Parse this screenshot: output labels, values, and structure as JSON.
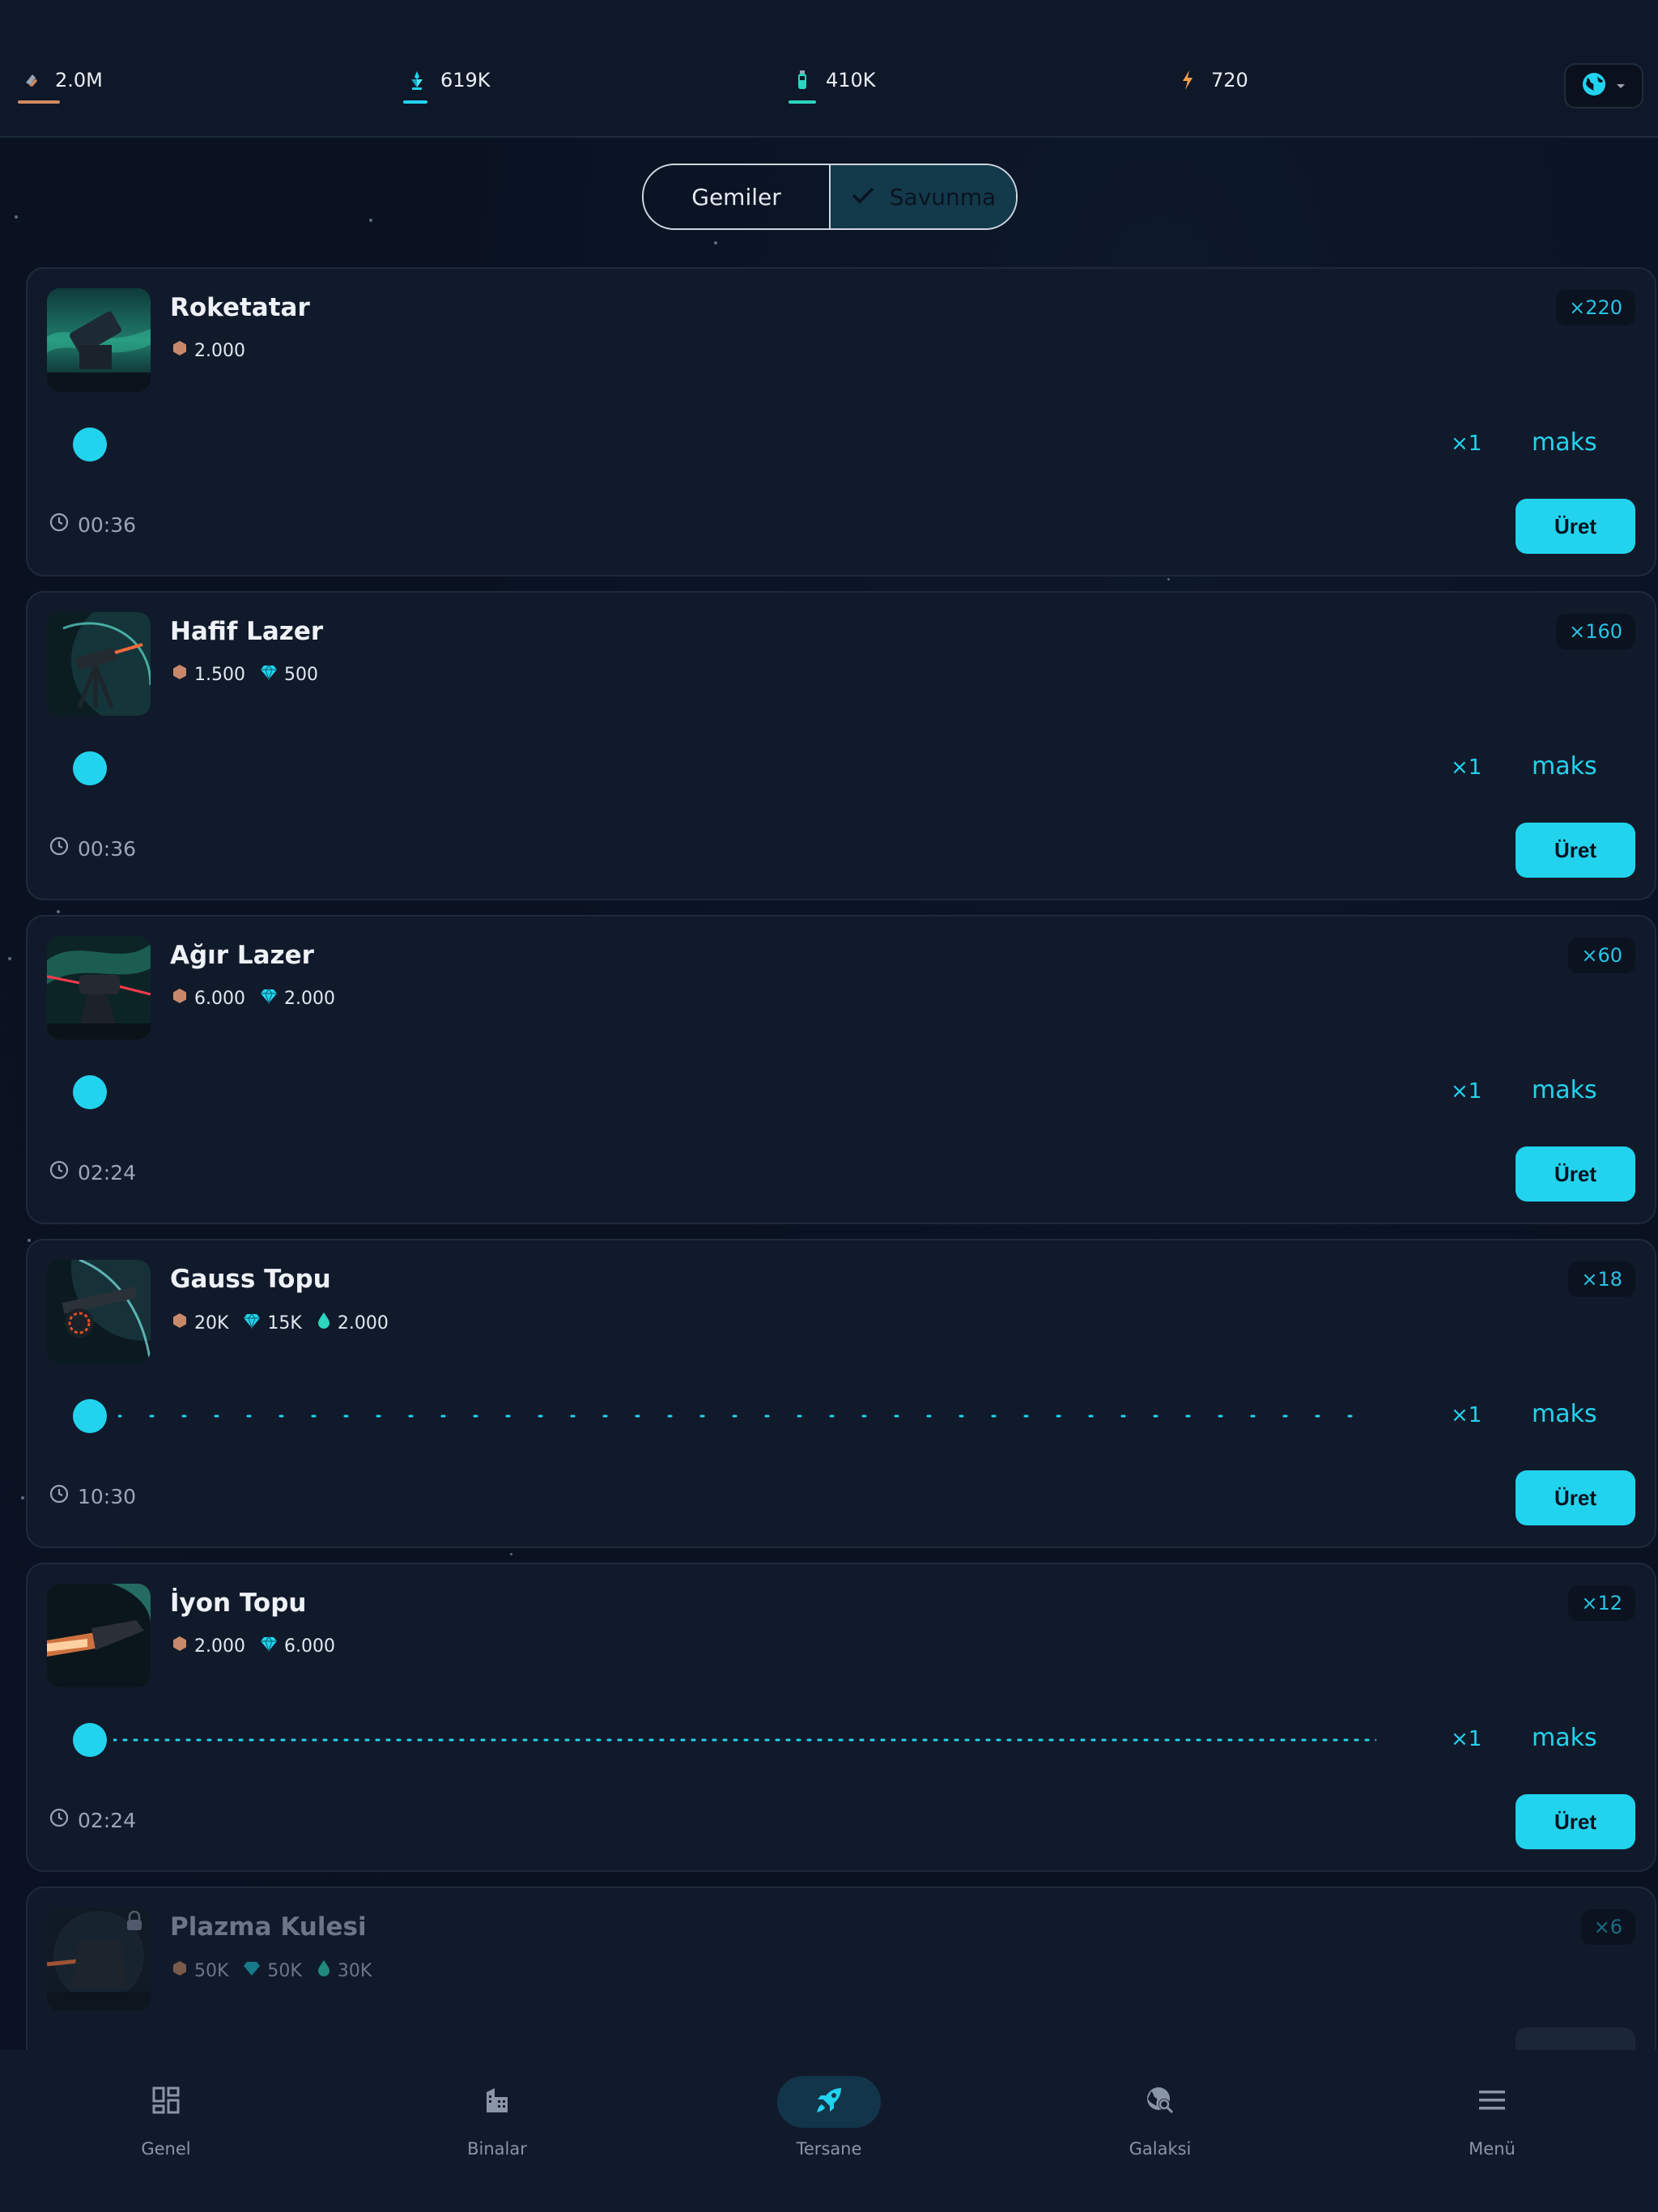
{
  "resources": [
    {
      "name": "metal",
      "value": "2.0M",
      "icon": "metal-icon",
      "color": "#d08a63"
    },
    {
      "name": "crystal",
      "value": "619K",
      "icon": "crystal-icon",
      "color": "#22d3ee"
    },
    {
      "name": "deuterium",
      "value": "410K",
      "icon": "deuterium-icon",
      "color": "#2dd4bf"
    },
    {
      "name": "energy",
      "value": "720",
      "icon": "energy-icon",
      "color": "#f5a04a"
    }
  ],
  "toggle": {
    "ships": "Gemiler",
    "defense": "Savunma",
    "active": "defense"
  },
  "items": [
    {
      "name": "Roketatar",
      "count": "×220",
      "costs": [
        {
          "type": "metal",
          "value": "2.000"
        }
      ],
      "mult": "×1",
      "max": "maks",
      "time": "00:36",
      "build": "Üret",
      "progress": 0.0
    },
    {
      "name": "Hafif Lazer",
      "count": "×160",
      "costs": [
        {
          "type": "metal",
          "value": "1.500"
        },
        {
          "type": "crystal",
          "value": "500"
        }
      ],
      "mult": "×1",
      "max": "maks",
      "time": "00:36",
      "build": "Üret",
      "progress": 0.0
    },
    {
      "name": "Ağır Lazer",
      "count": "×60",
      "costs": [
        {
          "type": "metal",
          "value": "6.000"
        },
        {
          "type": "crystal",
          "value": "2.000"
        }
      ],
      "mult": "×1",
      "max": "maks",
      "time": "02:24",
      "build": "Üret",
      "progress": 0.0
    },
    {
      "name": "Gauss Topu",
      "count": "×18",
      "costs": [
        {
          "type": "metal",
          "value": "20K"
        },
        {
          "type": "crystal",
          "value": "15K"
        },
        {
          "type": "deuterium",
          "value": "2.000"
        }
      ],
      "mult": "×1",
      "max": "maks",
      "time": "10:30",
      "build": "Üret",
      "progress": 0.0
    },
    {
      "name": "İyon Topu",
      "count": "×12",
      "costs": [
        {
          "type": "metal",
          "value": "2.000"
        },
        {
          "type": "crystal",
          "value": "6.000"
        }
      ],
      "mult": "×1",
      "max": "maks",
      "time": "02:24",
      "build": "Üret",
      "progress": 0.0
    },
    {
      "name": "Plazma Kulesi",
      "count": "×6",
      "costs": [
        {
          "type": "metal",
          "value": "50K"
        },
        {
          "type": "crystal",
          "value": "50K"
        },
        {
          "type": "deuterium",
          "value": "30K"
        }
      ],
      "mult": "",
      "max": "",
      "time": "",
      "build": "",
      "progress": 0.0
    }
  ],
  "nav": [
    {
      "label": "Genel",
      "icon": "dashboard-icon"
    },
    {
      "label": "Binalar",
      "icon": "buildings-icon"
    },
    {
      "label": "Tersane",
      "icon": "rocket-icon",
      "active": true
    },
    {
      "label": "Galaksi",
      "icon": "galaxy-search-icon"
    },
    {
      "label": "Menü",
      "icon": "hamburger-icon"
    }
  ],
  "colors": {
    "accent": "#22d3ee",
    "bg": "#0b1223",
    "card": "#111a2b"
  }
}
